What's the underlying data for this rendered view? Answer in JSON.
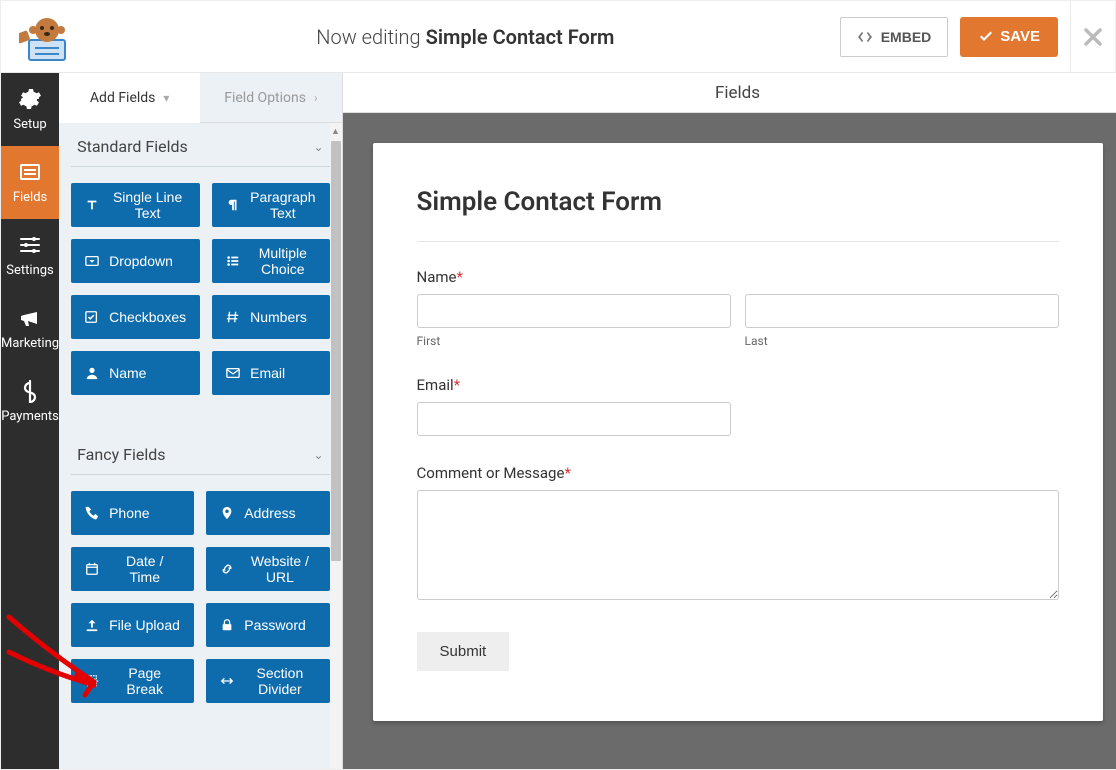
{
  "header": {
    "editing_prefix": "Now editing",
    "form_name": "Simple Contact Form",
    "embed_label": "EMBED",
    "save_label": "SAVE"
  },
  "sidenav": {
    "items": [
      {
        "id": "setup",
        "label": "Setup"
      },
      {
        "id": "fields",
        "label": "Fields"
      },
      {
        "id": "settings",
        "label": "Settings"
      },
      {
        "id": "marketing",
        "label": "Marketing"
      },
      {
        "id": "payments",
        "label": "Payments"
      }
    ]
  },
  "tabs": {
    "add_fields": "Add Fields",
    "field_options": "Field Options"
  },
  "sections": {
    "standard": {
      "title": "Standard Fields",
      "fields": [
        "Single Line Text",
        "Paragraph Text",
        "Dropdown",
        "Multiple Choice",
        "Checkboxes",
        "Numbers",
        "Name",
        "Email"
      ]
    },
    "fancy": {
      "title": "Fancy Fields",
      "fields": [
        "Phone",
        "Address",
        "Date / Time",
        "Website / URL",
        "File Upload",
        "Password",
        "Page Break",
        "Section Divider"
      ]
    }
  },
  "preview": {
    "panel_title": "Fields",
    "form_title": "Simple Contact Form",
    "name_label": "Name",
    "first_sub": "First",
    "last_sub": "Last",
    "email_label": "Email",
    "comment_label": "Comment or Message",
    "submit_label": "Submit",
    "required_marker": "*"
  }
}
